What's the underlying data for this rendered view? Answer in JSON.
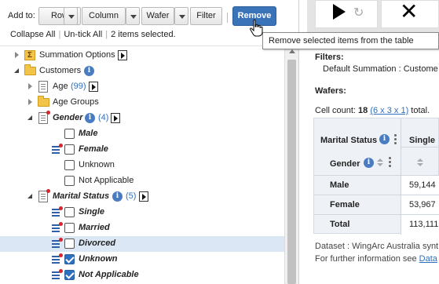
{
  "toolbar": {
    "add_to_label": "Add to:",
    "row_label": "Row",
    "column_label": "Column",
    "wafer_label": "Wafer",
    "filter_label": "Filter",
    "remove_label": "Remove"
  },
  "selection": {
    "collapse_all": "Collapse All",
    "untick_all": "Un-tick All",
    "items_selected": "2 items selected."
  },
  "tooltip": "Remove selected items from the table",
  "tree": {
    "summation_options": "Summation Options",
    "customers": "Customers",
    "age": "Age",
    "age_count": "(99)",
    "age_groups": "Age Groups",
    "gender": "Gender",
    "gender_count": "(4)",
    "gender_items": [
      "Male",
      "Female",
      "Unknown",
      "Not Applicable"
    ],
    "marital_status": "Marital Status",
    "marital_count": "(5)",
    "marital_items": [
      "Single",
      "Married",
      "Divorced",
      "Unknown",
      "Not Applicable"
    ]
  },
  "right_panel": {
    "filters_label": "Filters:",
    "default_summation": "Default Summation : Custome",
    "wafers_label": "Wafers:",
    "cell_count_prefix": "Cell count: ",
    "cell_count_value": "18",
    "cell_count_link": "(6 x 3 x 1)",
    "cell_count_suffix": " total.",
    "table": {
      "marital_status_header": "Marital Status",
      "single_header": "Single",
      "gender_header": "Gender",
      "rows": [
        {
          "label": "Male",
          "value": "59,144"
        },
        {
          "label": "Female",
          "value": "53,967"
        },
        {
          "label": "Total",
          "value": "113,111"
        }
      ]
    },
    "dataset_text": "Dataset : WingArc Australia synt",
    "further_text": "For further information see ",
    "further_link": "Data"
  }
}
